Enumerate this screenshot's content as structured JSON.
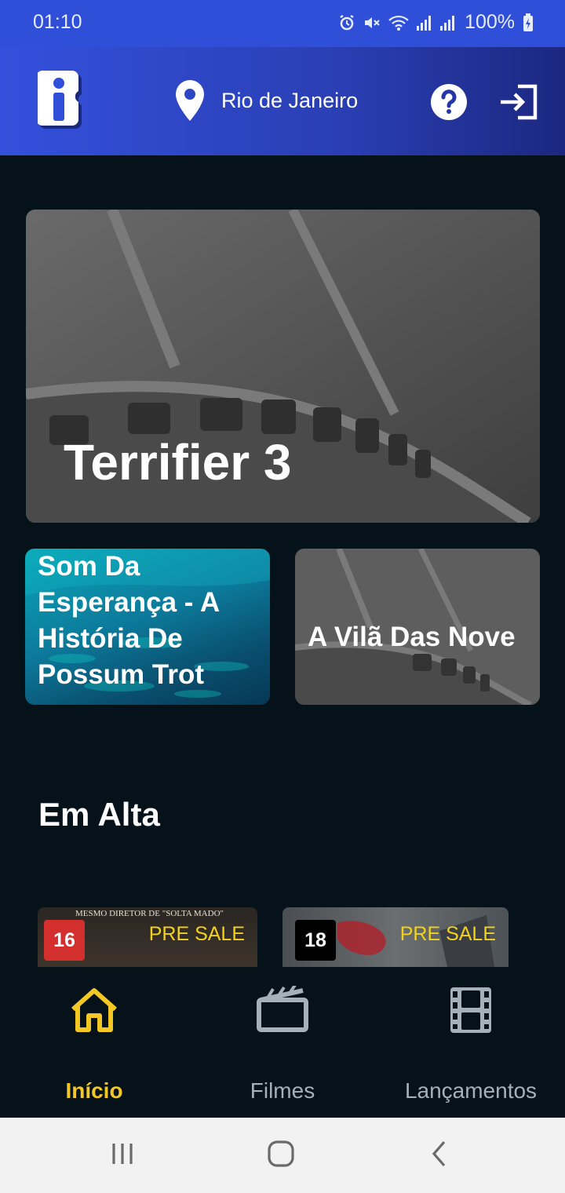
{
  "status": {
    "time": "01:10",
    "battery": "100%"
  },
  "header": {
    "location": "Rio de Janeiro",
    "icons": [
      "app-logo-icon",
      "location-pin-icon",
      "help-icon",
      "login-icon"
    ]
  },
  "featured": {
    "main": {
      "title": "Terrifier 3"
    },
    "cards": [
      {
        "title": "Som Da Esperança - A História De Possum Trot"
      },
      {
        "title": "A Vilã Das Nove"
      }
    ]
  },
  "trending": {
    "title": "Em Alta",
    "items": [
      {
        "rating": "16",
        "rating_color": "#d32f2f",
        "badge": "PRE SALE",
        "poster_text": "MESMO DIRETOR DE \"SOLTA MADO\""
      },
      {
        "rating": "18",
        "rating_color": "#000000",
        "badge": "PRE SALE"
      }
    ]
  },
  "tabs": [
    {
      "label": "Início",
      "icon": "home-icon",
      "active": true
    },
    {
      "label": "Filmes",
      "icon": "clapperboard-icon",
      "active": false
    },
    {
      "label": "Lançamentos",
      "icon": "film-strip-icon",
      "active": false
    }
  ],
  "colors": {
    "accent": "#f4c824",
    "header": "#2f4fd8",
    "background": "#05121a"
  }
}
